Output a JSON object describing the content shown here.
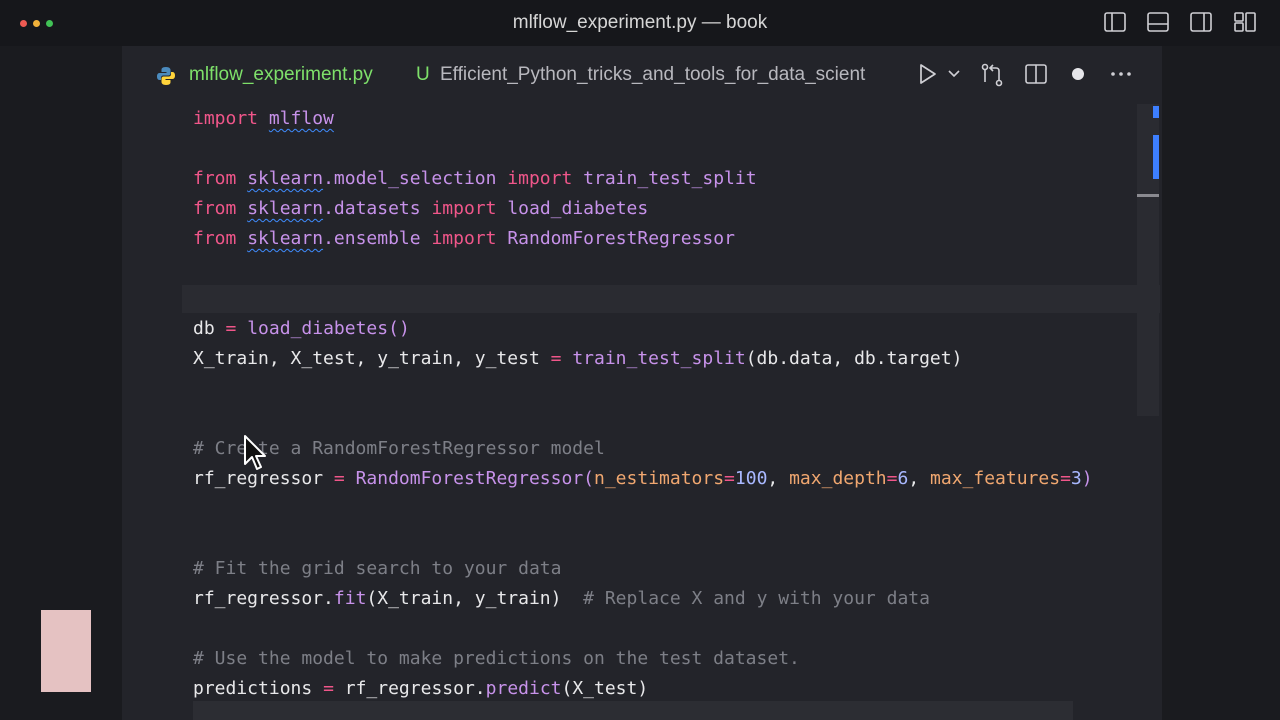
{
  "window": {
    "title": "mlflow_experiment.py — book",
    "traffic_colors": [
      "#ee5a52",
      "#f0b13a",
      "#41c256"
    ]
  },
  "tab": {
    "filename": "mlflow_experiment.py",
    "status": "U",
    "breadcrumb": "Efficient_Python_tricks_and_tools_for_data_scient",
    "language_icon": "python-icon"
  },
  "code_lines": {
    "l1": {
      "kw": "import",
      "mod": "mlflow"
    },
    "l2": {
      "kw1": "from",
      "mod": "sklearn",
      "rest": ".model_selection",
      "kw2": "import",
      "name": "train_test_split"
    },
    "l3": {
      "kw1": "from",
      "mod": "sklearn",
      "rest": ".datasets",
      "kw2": "import",
      "name": "load_diabetes"
    },
    "l4": {
      "kw1": "from",
      "mod": "sklearn",
      "rest": ".ensemble",
      "kw2": "import",
      "name": "RandomForestRegressor"
    },
    "l5": {
      "var": "db",
      "op": "=",
      "fn": "load_diabetes",
      "tail": "()"
    },
    "l6": {
      "vars": "X_train, X_test, y_train, y_test",
      "op": "=",
      "fn": "train_test_split",
      "args": "(db.data, db.target)"
    },
    "l7": {
      "comment": "# Create a RandomForestRegressor model"
    },
    "l8": {
      "var": "rf_regressor",
      "op": "=",
      "fn": "RandomForestRegressor",
      "open": "(",
      "p1": "n_estimators",
      "eq1": "=",
      "v1": "100",
      "sep1": ", ",
      "p2": "max_depth",
      "eq2": "=",
      "v2": "6",
      "sep2": ", ",
      "p3": "max_features",
      "eq3": "=",
      "v3": "3",
      "close": ")"
    },
    "l9": {
      "comment": "# Fit the grid search to your data"
    },
    "l10": {
      "obj": "rf_regressor",
      "dot": ".",
      "fn": "fit",
      "args": "(X_train, y_train)",
      "comment": "# Replace X and y with your data"
    },
    "l11": {
      "comment": "# Use the model to make predictions on the test dataset."
    },
    "l12": {
      "var": "predictions",
      "op": "=",
      "obj": "rf_regressor",
      "dot": ".",
      "fn": "predict",
      "args": "(X_test)"
    }
  },
  "colors": {
    "added_file": "#7ee06a",
    "keyword": "#f0568a",
    "function": "#c792ea",
    "number": "#a9b8ff",
    "parameter": "#f0a770",
    "comment": "#7d7f87"
  }
}
